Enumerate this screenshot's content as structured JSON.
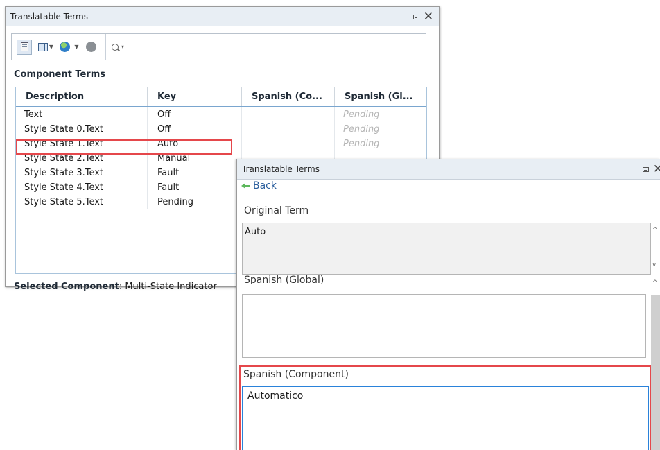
{
  "panel1": {
    "title": "Translatable Terms",
    "close_icon": "✕",
    "search_placeholder": "",
    "section_label": "Component Terms",
    "table": {
      "headers": [
        "Description",
        "Key",
        "Spanish (Co...",
        "Spanish (Gl..."
      ],
      "rows": [
        {
          "description": "Text",
          "key": "Off",
          "spanish_component": "",
          "spanish_global": "Pending"
        },
        {
          "description": "Style State 0.Text",
          "key": "Off",
          "spanish_component": "",
          "spanish_global": "Pending"
        },
        {
          "description": "Style State 1.Text",
          "key": "Auto",
          "spanish_component": "",
          "spanish_global": "Pending"
        },
        {
          "description": "Style State 2.Text",
          "key": "Manual",
          "spanish_component": "",
          "spanish_global": ""
        },
        {
          "description": "Style State 3.Text",
          "key": "Fault",
          "spanish_component": "",
          "spanish_global": ""
        },
        {
          "description": "Style State 4.Text",
          "key": "Fault",
          "spanish_component": "",
          "spanish_global": ""
        },
        {
          "description": "Style State 5.Text",
          "key": "Pending",
          "spanish_component": "",
          "spanish_global": ""
        }
      ]
    },
    "selected_label": "Selected Component",
    "selected_value": ": Multi-State Indicator"
  },
  "panel2": {
    "title": "Translatable Terms",
    "close_icon": "✕",
    "back_label": "Back",
    "original_term_label": "Original Term",
    "original_term_value": "Auto",
    "spanish_global_label": "Spanish (Global)",
    "spanish_global_value": "",
    "spanish_component_label": "Spanish (Component)",
    "spanish_component_value": "Automatico"
  },
  "highlight_color": "#e5474b",
  "accent_color": "#2a82da",
  "icons": [
    "terms-list-icon",
    "grid-view-icon",
    "globe-icon",
    "status-circle-icon",
    "search-icon",
    "minimize-icon",
    "close-icon",
    "back-arrow-icon"
  ]
}
